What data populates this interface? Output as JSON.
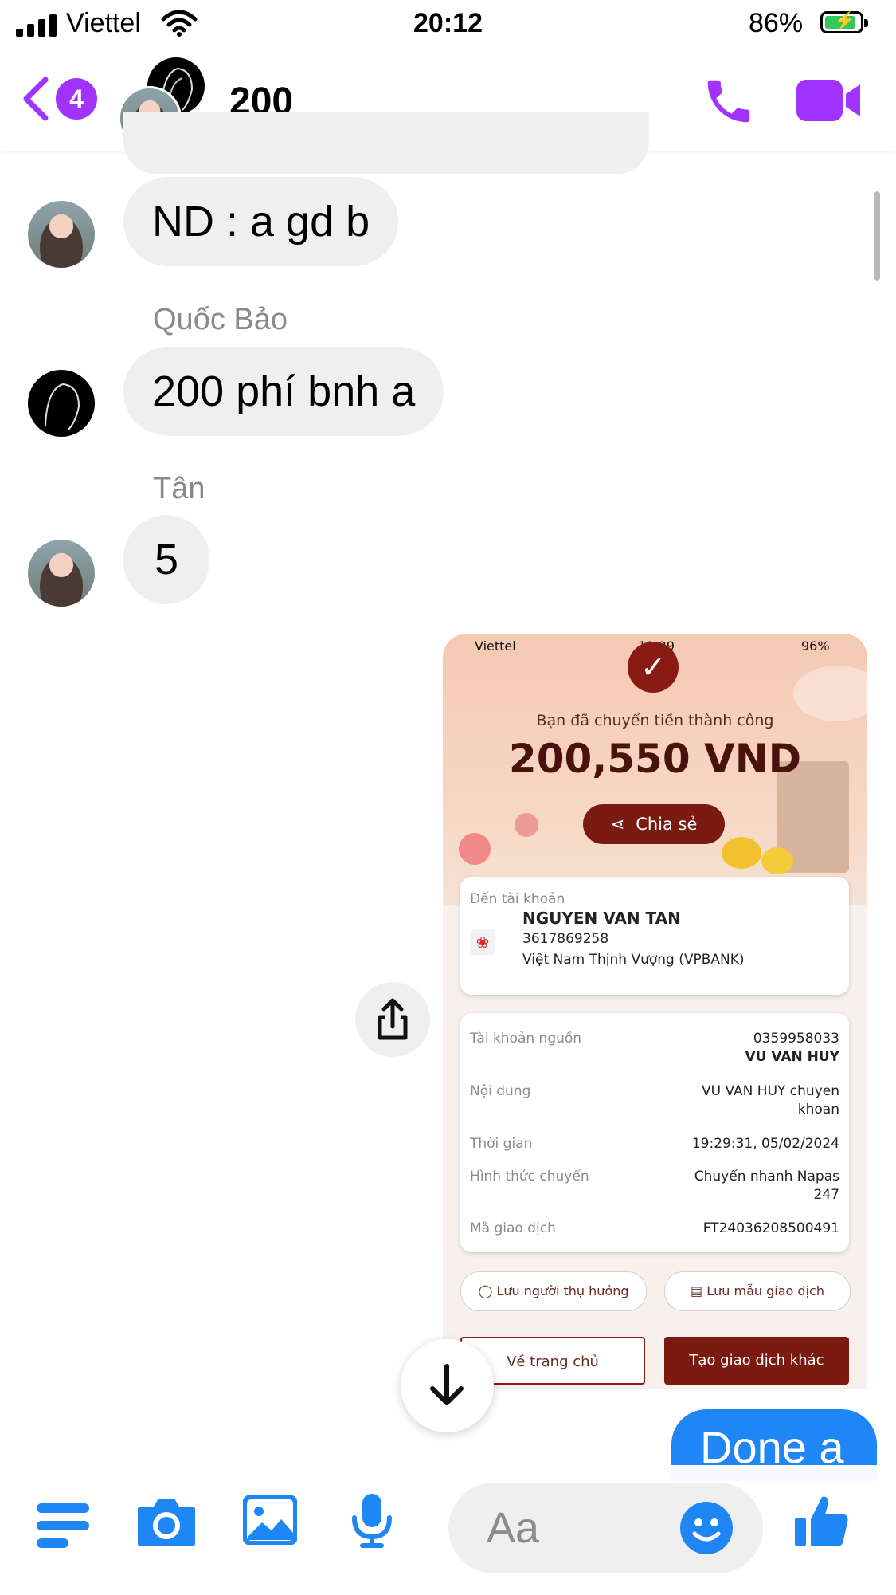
{
  "status_bar": {
    "carrier": "Viettel",
    "time": "20:12",
    "battery": "86%"
  },
  "header": {
    "unread_count": "4",
    "title": "200"
  },
  "messages": [
    {
      "text": "ND : a gd b"
    },
    {
      "sender": "Quốc Bảo",
      "text": "200 phí bnh a"
    },
    {
      "sender": "Tân",
      "text": "5"
    }
  ],
  "receipt": {
    "status_carrier": "Viettel",
    "status_time": "19:29",
    "status_battery": "96%",
    "message": "Bạn đã chuyển tiền thành công",
    "amount": "200,550 VND",
    "share_label": "Chia sẻ",
    "dest_label": "Đến tài khoản",
    "dest_name": "NGUYEN VAN TAN",
    "dest_number": "3617869258",
    "dest_bank": "Việt Nam Thịnh Vượng (VPBANK)",
    "rows": [
      {
        "label": "Tài khoản nguồn",
        "value": "0359958033",
        "value2": "VU VAN HUY"
      },
      {
        "label": "Nội dung",
        "value": "VU VAN HUY chuyen",
        "value2": "khoan"
      },
      {
        "label": "Thời gian",
        "value": "19:29:31, 05/02/2024"
      },
      {
        "label": "Hình thức chuyển",
        "value": "Chuyển nhanh Napas",
        "value2": "247"
      },
      {
        "label": "Mã giao dịch",
        "value": "FT24036208500491"
      }
    ],
    "save_beneficiary": "Lưu người thụ hưởng",
    "save_template": "Lưu mẫu giao dịch",
    "home_button": "Về trang chủ",
    "new_transaction": "Tạo giao dịch khác"
  },
  "outgoing_message": "Done a",
  "composer": {
    "placeholder": "Aa"
  },
  "colors": {
    "accent": "#a033ff",
    "messenger_blue": "#1f86f5",
    "bank_red": "#8a1b14"
  }
}
